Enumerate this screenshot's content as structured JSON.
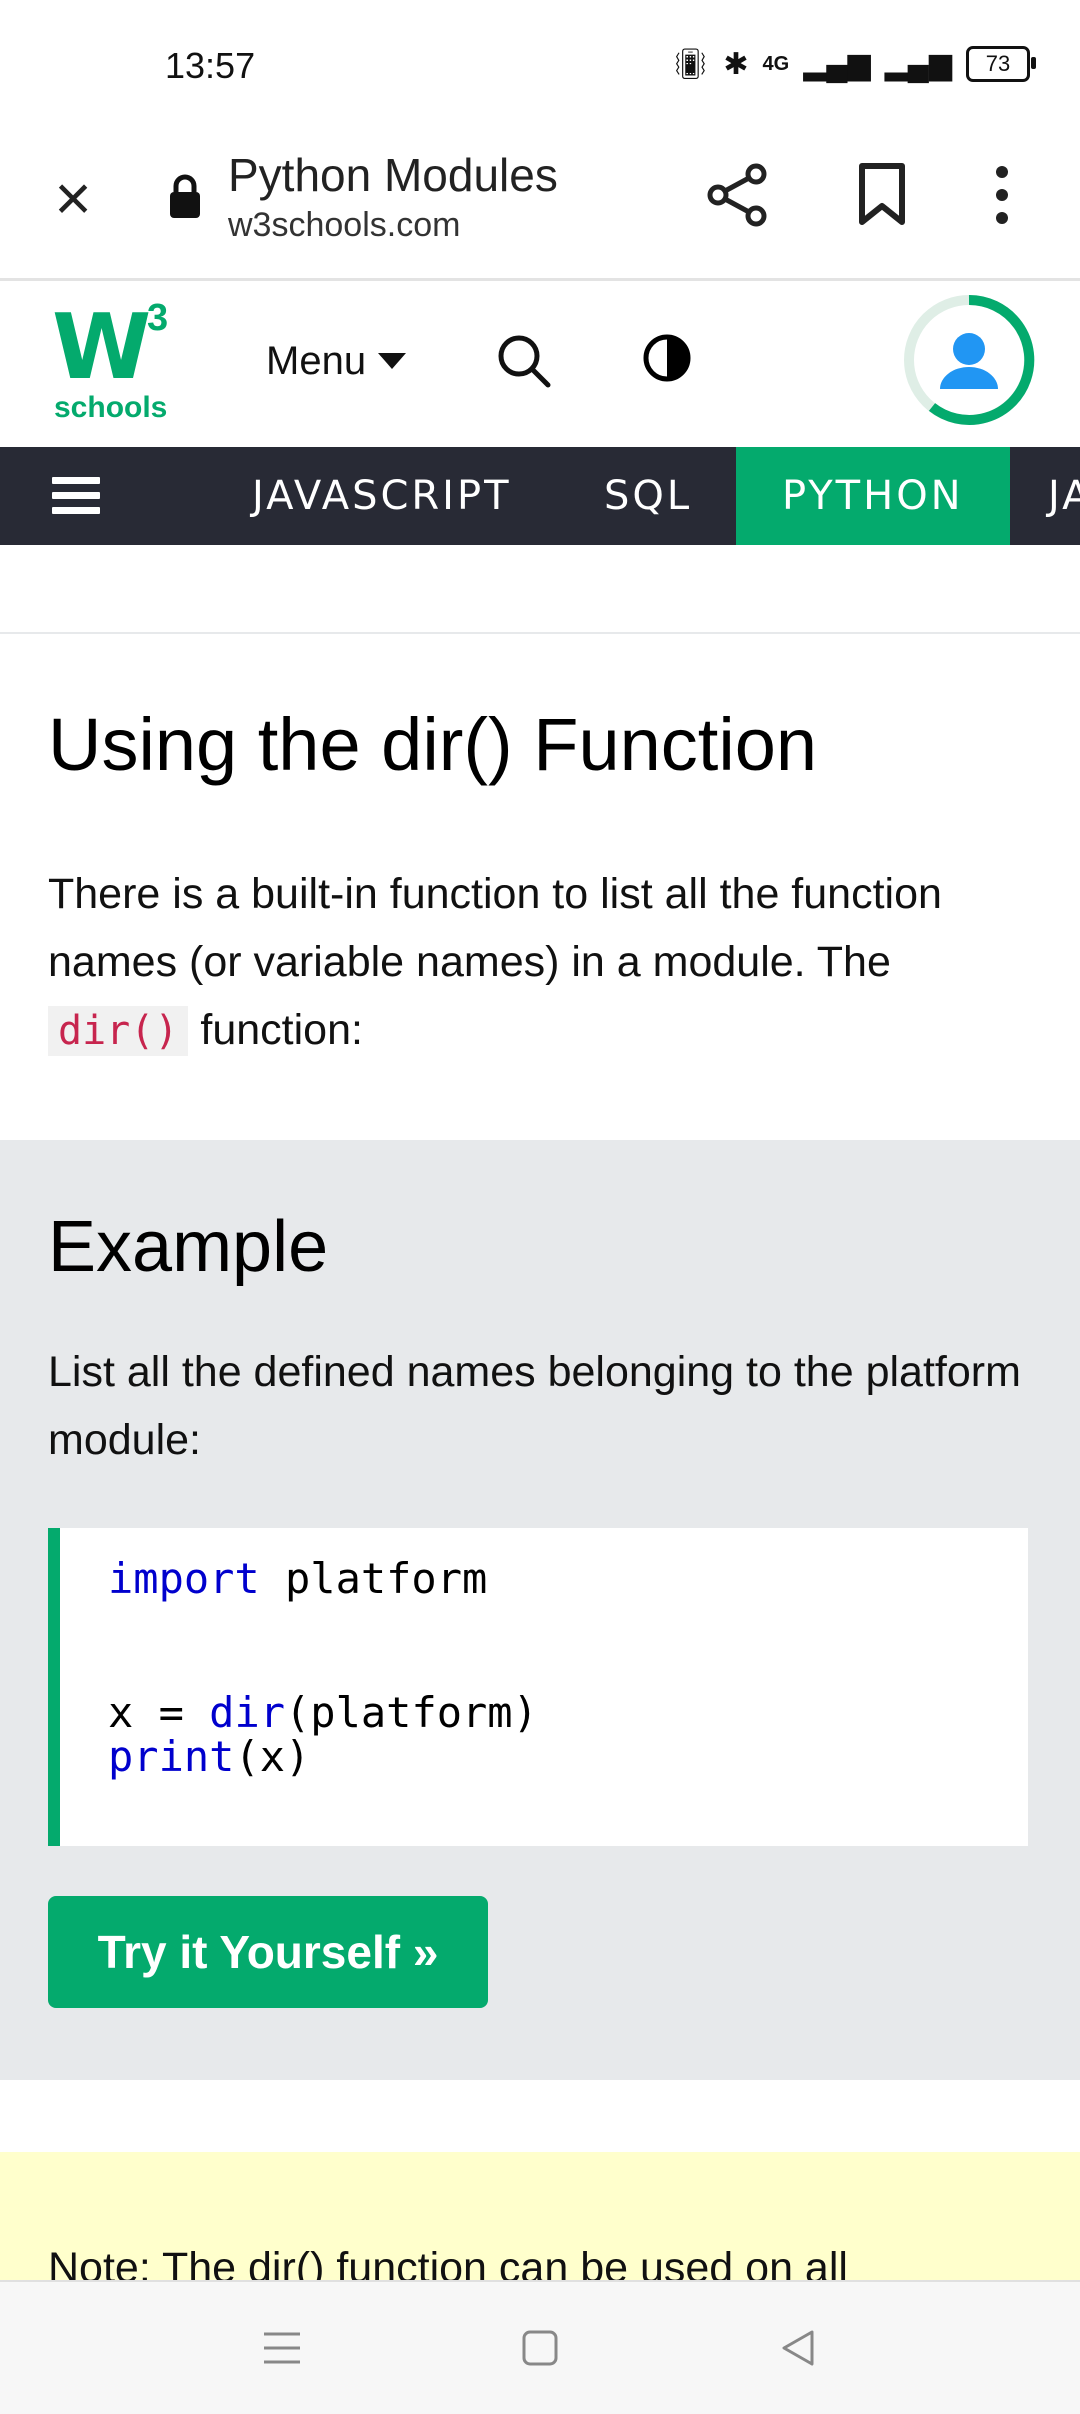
{
  "status_bar": {
    "time": "13:57",
    "network": "4G",
    "battery": "73"
  },
  "browser": {
    "page_title": "Python Modules",
    "url": "w3schools.com",
    "icons": [
      "close-icon",
      "lock-icon",
      "share-icon",
      "bookmark-icon",
      "more-vert-icon"
    ]
  },
  "site_header": {
    "logo_main": "W",
    "logo_superscript": "3",
    "logo_text": "schools",
    "menu_label": "Menu",
    "brand_color": "#04aa6d"
  },
  "nav": {
    "items": [
      {
        "label": "JAVASCRIPT",
        "active": false
      },
      {
        "label": "SQL",
        "active": false
      },
      {
        "label": "PYTHON",
        "active": true
      },
      {
        "label": "JA",
        "active": false
      }
    ],
    "background": "#282a35",
    "active_color": "#04aa6d"
  },
  "content": {
    "heading": "Using the dir() Function",
    "paragraph_part1": "There is a built-in function to list all the function names (or variable names) in a module. The",
    "paragraph_code": "dir()",
    "paragraph_part2": "function:"
  },
  "example": {
    "heading": "Example",
    "description": "List all the defined names belonging to the platform module:",
    "code": {
      "line1_kw": "import",
      "line1_rest": " platform",
      "line3_pre": "x = ",
      "line3_kw": "dir",
      "line3_rest": "(platform)",
      "line4_kw": "print",
      "line4_rest": "(x)"
    },
    "button_label": "Try it Yourself »"
  },
  "note": {
    "partial_text": "Note: The dir() function can be used on all"
  },
  "system_nav": {
    "icons": [
      "recents-icon",
      "home-icon",
      "back-icon"
    ]
  }
}
